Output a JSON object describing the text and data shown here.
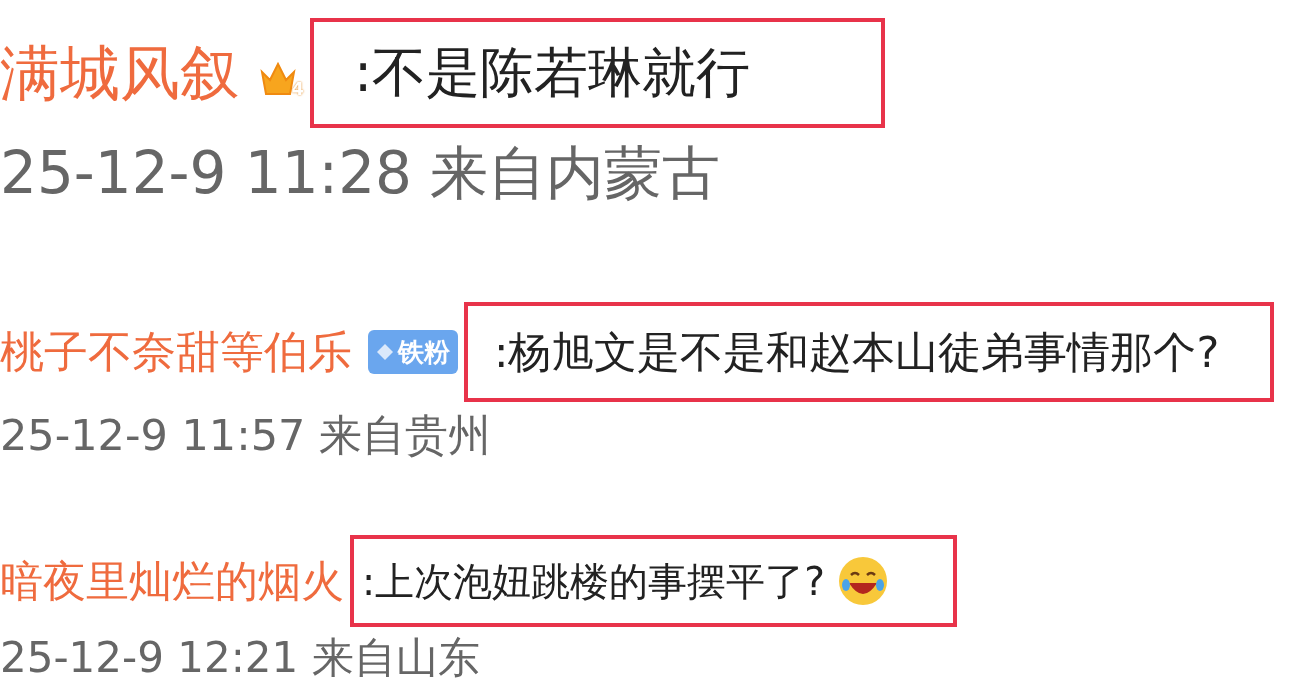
{
  "comments": [
    {
      "user": "满城风叙",
      "badge": {
        "kind": "crown",
        "text": "4"
      },
      "text": ":不是陈若琳就行",
      "emoji": false,
      "time": "25-12-9 11:28 来自内蒙古"
    },
    {
      "user": "桃子不奈甜等伯乐",
      "badge": {
        "kind": "fan",
        "text": "铁粉"
      },
      "text": ":杨旭文是不是和赵本山徒弟事情那个?",
      "emoji": false,
      "time": "25-12-9 11:57 来自贵州"
    },
    {
      "user": "暗夜里灿烂的烟火",
      "text": ":上次泡妞跳楼的事摆平了?",
      "emoji": true,
      "time": "25-12-9 12:21 来自山东"
    }
  ]
}
